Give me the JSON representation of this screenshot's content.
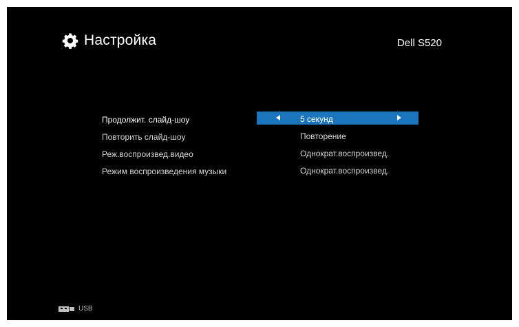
{
  "header": {
    "title": "Настройка",
    "icon": "gear-icon",
    "model": "Dell S520"
  },
  "menu": {
    "items": [
      {
        "label": "Продолжит. слайд-шоу",
        "value": "5 секунд",
        "selected": true
      },
      {
        "label": "Повторить слайд-шоу",
        "value": "Повторение",
        "selected": false
      },
      {
        "label": "Реж.воспроизвед.видео",
        "value": "Однократ.воспроизвед.",
        "selected": false
      },
      {
        "label": "Режим воспроизведения музыки",
        "value": "Однократ.воспроизвед.",
        "selected": false
      }
    ]
  },
  "footer": {
    "source_icon": "usb-icon",
    "source_label": "USB"
  },
  "colors": {
    "background": "#000000",
    "highlight": "#1a75bc",
    "text": "#ffffff"
  }
}
